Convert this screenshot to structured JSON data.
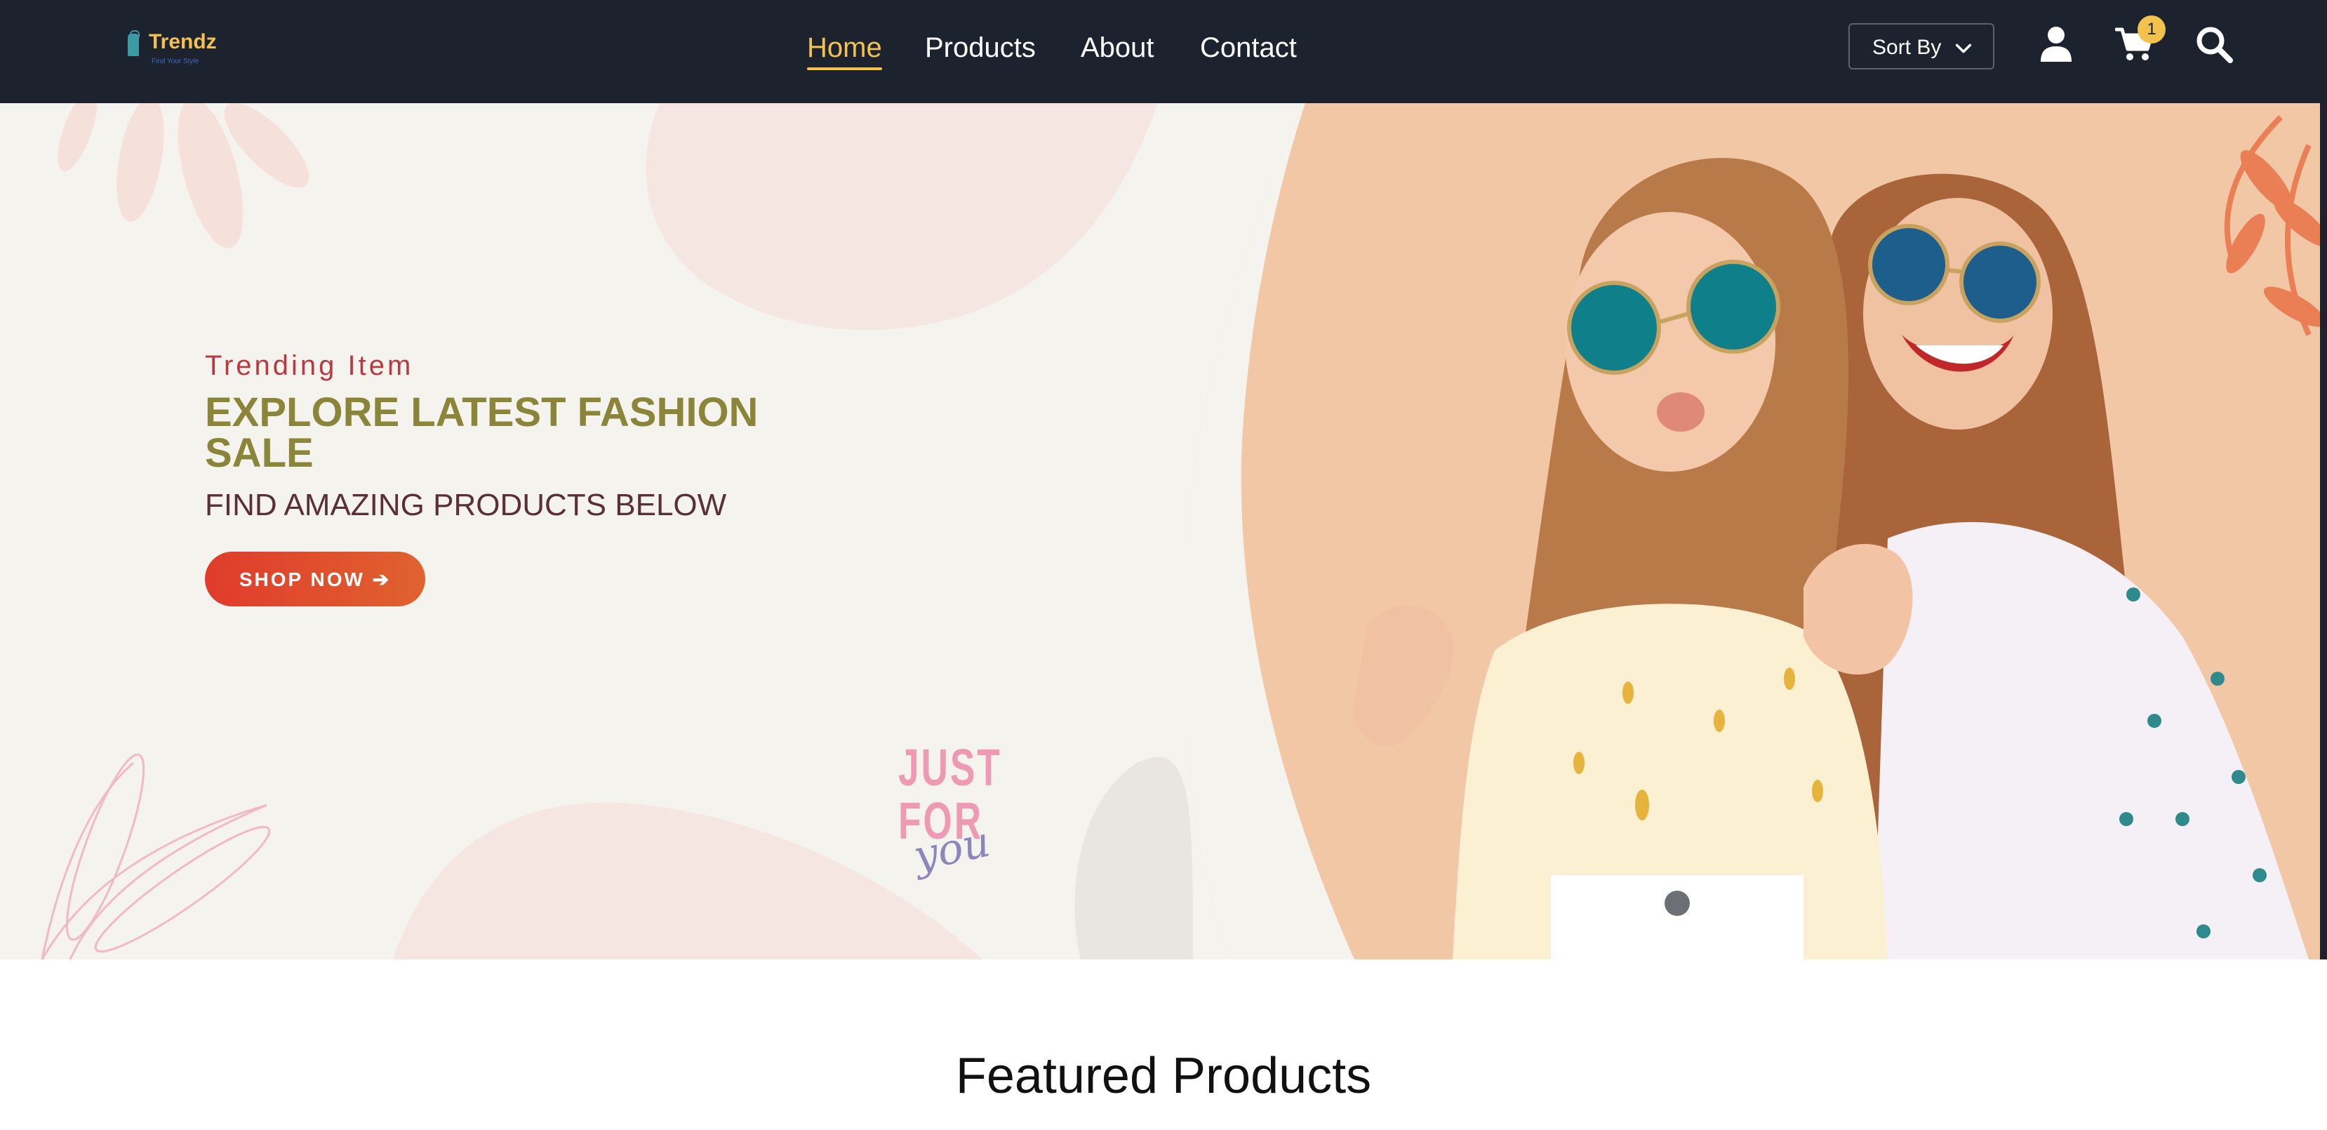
{
  "brand": {
    "name": "Trendz",
    "tagline": "Find Your Style"
  },
  "nav": {
    "links": [
      {
        "label": "Home",
        "active": true
      },
      {
        "label": "Products",
        "active": false
      },
      {
        "label": "About",
        "active": false
      },
      {
        "label": "Contact",
        "active": false
      }
    ]
  },
  "toolbar": {
    "sort_label": "Sort By",
    "user_icon": "user-icon",
    "cart_icon": "cart-icon",
    "cart_count": "1",
    "search_icon": "search-icon"
  },
  "hero": {
    "eyebrow": "Trending Item",
    "heading": "EXPLORE LATEST FASHION SALE",
    "subheading": "FIND AMAZING PRODUCTS BELOW",
    "cta_label": "SHOP NOW ➔",
    "badge_line1": "JUST",
    "badge_line2": "FOR",
    "badge_script": "you"
  },
  "featured": {
    "title": "Featured Products"
  },
  "colors": {
    "nav_bg": "#1c222e",
    "accent": "#f2c14e",
    "eyebrow": "#b83a40",
    "heading": "#8a8538",
    "subheading": "#5a2f38",
    "cta": "#e03b2c",
    "hero_bg": "#f5f3ee"
  }
}
